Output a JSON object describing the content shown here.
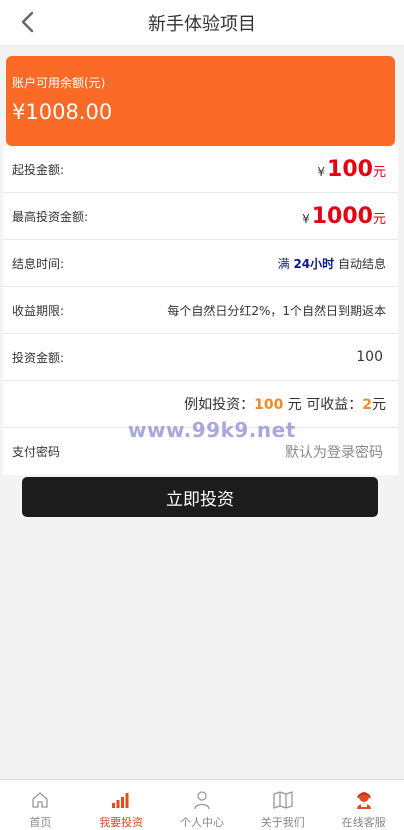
{
  "header": {
    "title": "新手体验项目"
  },
  "balance": {
    "label": "账户可用余额(元)",
    "value": "¥1008.00"
  },
  "rows": {
    "min_invest": {
      "label": "起投金额:",
      "currency": "¥",
      "amount": "100",
      "unit": "元"
    },
    "max_invest": {
      "label": "最高投资金额:",
      "currency": "¥",
      "amount": "1000",
      "unit": "元"
    },
    "settle_time": {
      "label": "结息时间:",
      "prefix": "满",
      "hours": "24小时",
      "suffix": "自动结息"
    },
    "term": {
      "label": "收益期限:",
      "text": "每个自然日分红2%，1个自然日到期返本"
    },
    "invest_amount": {
      "label": "投资金额:",
      "value": "100"
    },
    "example": {
      "prefix": "例如投资：",
      "amount": "100",
      "mid": "元 可收益：",
      "profit": "2",
      "unit": "元"
    },
    "pay_password": {
      "label": "支付密码",
      "placeholder": "默认为登录密码"
    }
  },
  "watermark": "www.99k9.net",
  "invest_button": "立即投资",
  "tabbar": [
    {
      "label": "首页",
      "icon": "home-icon",
      "active": false
    },
    {
      "label": "我要投资",
      "icon": "bar-chart-icon",
      "active": true
    },
    {
      "label": "个人中心",
      "icon": "user-icon",
      "active": false
    },
    {
      "label": "关于我们",
      "icon": "map-icon",
      "active": false
    },
    {
      "label": "在线客服",
      "icon": "customer-service-icon",
      "active": false
    }
  ],
  "colors": {
    "accent": "#fb6a27",
    "red": "#e60012",
    "blue": "#0c1a8a",
    "orange": "#f08a24",
    "button": "#1c1c1c",
    "active_tab": "#e24a1f"
  }
}
